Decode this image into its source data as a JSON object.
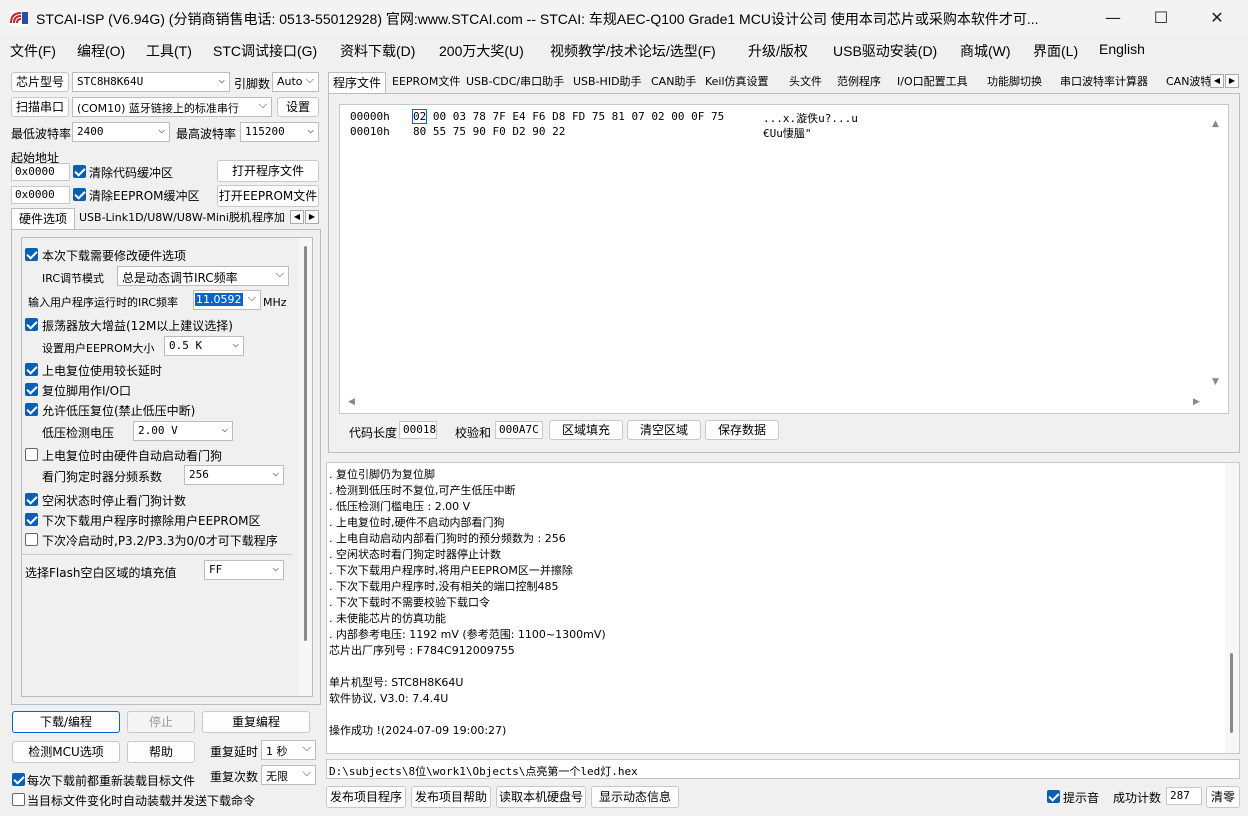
{
  "window": {
    "title": "STCAI-ISP (V6.94G) (分销商销售电话: 0513-55012928) 官网:www.STCAI.com  -- STCAI: 车规AEC-Q100 Grade1 MCU设计公司 使用本司芯片或采购本软件才可..."
  },
  "menu": [
    "文件(F)",
    "编程(O)",
    "工具(T)",
    "STC调试接口(G)",
    "资料下载(D)",
    "200万大奖(U)",
    "视频教学/技术论坛/选型(F)",
    "升级/版权",
    "USB驱动安装(D)",
    "商城(W)",
    "界面(L)",
    "English"
  ],
  "left": {
    "chip_label": "芯片型号",
    "chip_value": "STC8H8K64U",
    "pins_label": "引脚数",
    "pins_value": "Auto",
    "scan_label": "扫描串口",
    "port_value": "(COM10) 蓝牙链接上的标准串行",
    "settings_label": "设置",
    "min_baud_label": "最低波特率",
    "min_baud": "2400",
    "max_baud_label": "最高波特率",
    "max_baud": "115200",
    "start_addr_label": "起始地址",
    "addr1": "0x0000",
    "clear_code": "清除代码缓冲区",
    "open_prog": "打开程序文件",
    "addr2": "0x0000",
    "clear_eeprom": "清除EEPROM缓冲区",
    "open_eeprom": "打开EEPROM文件",
    "tabs": [
      "硬件选项",
      "USB-Link1D/U8W/U8W-Mini脱机",
      "程序加"
    ],
    "opts": {
      "modify_hw": "本次下载需要修改硬件选项",
      "irc_mode_label": "IRC调节模式",
      "irc_mode": "总是动态调节IRC频率",
      "irc_freq_label": "输入用户程序运行时的IRC频率",
      "irc_freq": "11.0592",
      "mhz": "MHz",
      "osc_gain": "振荡器放大增益(12M以上建议选择)",
      "eeprom_size_label": "设置用户EEPROM大小",
      "eeprom_size": "0.5 K",
      "long_delay": "上电复位使用较长延时",
      "reset_io": "复位脚用作I/O口",
      "lvr": "允许低压复位(禁止低压中断)",
      "lv_label": "低压检测电压",
      "lv_value": "2.00 V",
      "wdt_auto": "上电复位时由硬件自动启动看门狗",
      "wdt_div_label": "看门狗定时器分频系数",
      "wdt_div": "256",
      "idle_wdt": "空闲状态时停止看门狗计数",
      "erase_eeprom": "下次下载用户程序时擦除用户EEPROM区",
      "p32": "下次冷启动时,P3.2/P3.3为0/0才可下载程序",
      "flash_fill_label": "选择Flash空白区域的填充值",
      "flash_fill": "FF"
    },
    "download": "下载/编程",
    "stop": "停止",
    "reprogram": "重复编程",
    "check_mcu": "检测MCU选项",
    "help": "帮助",
    "repeat_delay_label": "重复延时",
    "repeat_delay": "1 秒",
    "reload_file": "每次下载前都重新装载目标文件",
    "repeat_count_label": "重复次数",
    "repeat_count": "无限",
    "auto_send": "当目标文件变化时自动装载并发送下载命令"
  },
  "right": {
    "tabs": [
      "程序文件",
      "EEPROM文件",
      "USB-CDC/串口助手",
      "USB-HID助手",
      "CAN助手",
      "Keil仿真设置",
      "头文件",
      "范例程序",
      "I/O口配置工具",
      "功能脚切换",
      "串口波特率计算器",
      "CAN波特"
    ],
    "hex": [
      {
        "addr": "00000h",
        "bytes": "02 00 03 78 7F E4 F6 D8 FD 75 81 07 02 00 0F 75",
        "ascii": "...x.漩佚u?...u"
      },
      {
        "addr": "00010h",
        "bytes": "80 55 75 90 F0 D2 90 22",
        "ascii": "€Uu悽膃\""
      }
    ],
    "code_len_label": "代码长度",
    "code_len": "00018",
    "checksum_label": "校验和",
    "checksum": "000A7C",
    "fill": "区域填充",
    "clear": "清空区域",
    "save": "保存数据",
    "log": [
      "  . 复位引脚仍为复位脚",
      "  . 检测到低压时不复位,可产生低压中断",
      "  . 低压检测门槛电压 : 2.00 V",
      "  . 上电复位时,硬件不启动内部看门狗",
      "  . 上电自动启动内部看门狗时的预分频数为 : 256",
      "  . 空闲状态时看门狗定时器停止计数",
      "  . 下次下载用户程序时,将用户EEPROM区一并擦除",
      "  . 下次下载用户程序时,没有相关的端口控制485",
      "  . 下次下载时不需要校验下载口令",
      "  . 未使能芯片的仿真功能",
      "  . 内部参考电压: 1192 mV (参考范围: 1100~1300mV)",
      "芯片出厂序列号 : F784C912009755",
      "",
      "  单片机型号: STC8H8K64U",
      "  软件协议, V3.0: 7.4.4U",
      "",
      "操作成功 !(2024-07-09 19:00:27)"
    ],
    "path": "D:\\subjects\\8位\\work1\\Objects\\点亮第一个led灯.hex",
    "publish_prog": "发布项目程序",
    "publish_help": "发布项目帮助",
    "read_disk": "读取本机硬盘号",
    "show_dyn": "显示动态信息",
    "sound": "提示音",
    "success_label": "成功计数",
    "success_count": "287",
    "clear_count": "清零"
  }
}
